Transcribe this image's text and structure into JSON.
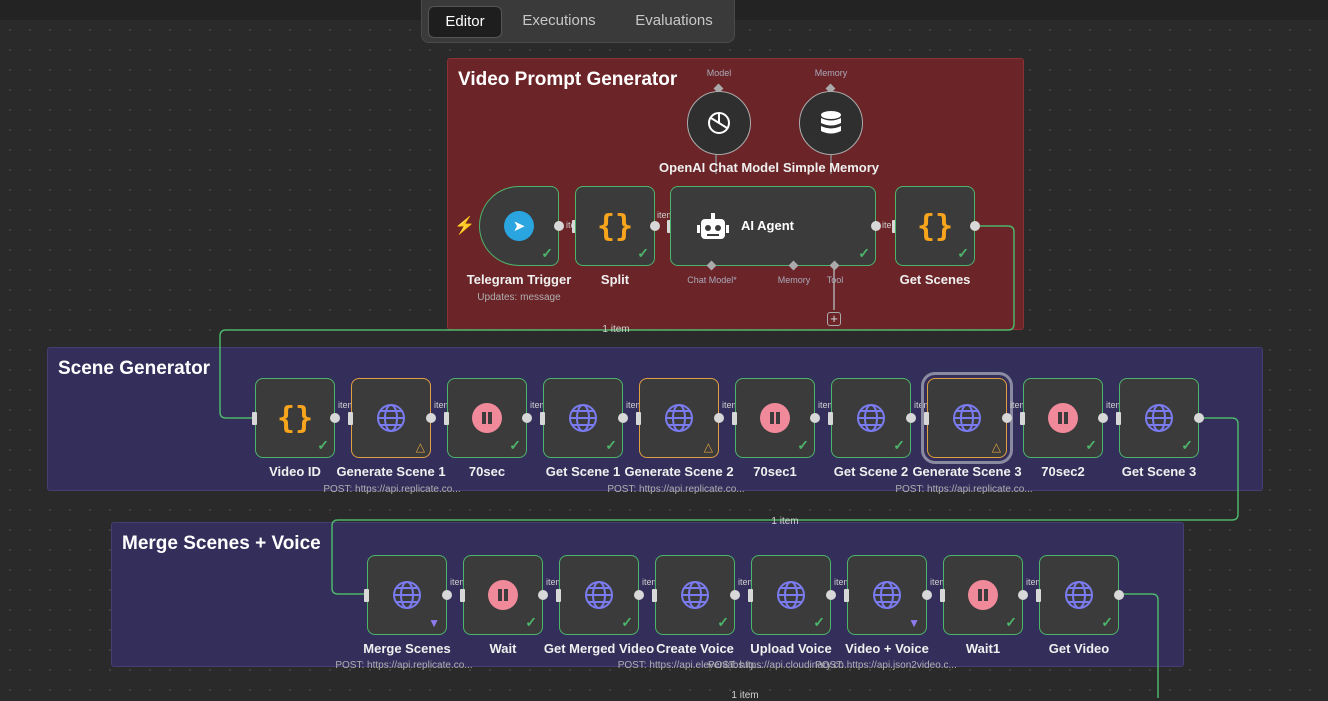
{
  "tabs": [
    "Editor",
    "Executions",
    "Evaluations"
  ],
  "active_tab": "Editor",
  "colors": {
    "success": "#4db56b",
    "warning": "#e0a040",
    "trigger": "#ff5a3c",
    "group_red": "#6b2528",
    "group_purple": "#342e5a"
  },
  "groups": {
    "video_prompt": {
      "title": "Video Prompt Generator"
    },
    "scene_gen": {
      "title": "Scene Generator"
    },
    "merge": {
      "title": "Merge Scenes + Voice"
    }
  },
  "vp": {
    "openai": {
      "name": "OpenAI Chat Model",
      "port": "Model"
    },
    "memory": {
      "name": "Simple Memory",
      "port": "Memory"
    },
    "telegram": {
      "name": "Telegram Trigger",
      "sub": "Updates: message"
    },
    "split": {
      "name": "Split"
    },
    "agent": {
      "name": "AI Agent",
      "ports": [
        "Chat Model*",
        "Memory",
        "Tool"
      ]
    },
    "get_scenes": {
      "name": "Get Scenes"
    }
  },
  "scene_nodes": [
    {
      "name": "Video ID",
      "icon": "braces-icon"
    },
    {
      "name": "Generate Scene 1",
      "icon": "globe-icon",
      "status": "warning"
    },
    {
      "name": "70sec",
      "icon": "pause-icon"
    },
    {
      "name": "Get Scene 1",
      "icon": "globe-icon"
    },
    {
      "name": "Generate Scene 2",
      "icon": "globe-icon",
      "status": "warning"
    },
    {
      "name": "70sec1",
      "icon": "pause-icon"
    },
    {
      "name": "Get Scene 2",
      "icon": "globe-icon"
    },
    {
      "name": "Generate Scene 3",
      "icon": "globe-icon",
      "status": "warning"
    },
    {
      "name": "70sec2",
      "icon": "pause-icon"
    },
    {
      "name": "Get Scene 3",
      "icon": "globe-icon"
    }
  ],
  "scene_subs": [
    "POST: https://api.replicate.co...",
    "POST: https://api.replicate.co...",
    "POST: https://api.replicate.co..."
  ],
  "merge_nodes": [
    {
      "name": "Merge Scenes",
      "icon": "globe-icon",
      "status": "pinned"
    },
    {
      "name": "Wait",
      "icon": "pause-icon"
    },
    {
      "name": "Get Merged Video",
      "icon": "globe-icon"
    },
    {
      "name": "Create Voice",
      "icon": "globe-icon"
    },
    {
      "name": "Upload Voice",
      "icon": "globe-icon"
    },
    {
      "name": "Video + Voice",
      "icon": "globe-icon",
      "status": "pinned"
    },
    {
      "name": "Wait1",
      "icon": "pause-icon"
    },
    {
      "name": "Get Video",
      "icon": "globe-icon"
    }
  ],
  "merge_subs": [
    "POST: https://api.replicate.co...",
    "POST: https://api.elevenlabs.io...",
    "POST: https://api.cloudinary.co...",
    "POST: https://api.json2video.c..."
  ],
  "edge_counts": [
    "1 item",
    "1 item",
    "1 item"
  ],
  "edge_tag": "item"
}
